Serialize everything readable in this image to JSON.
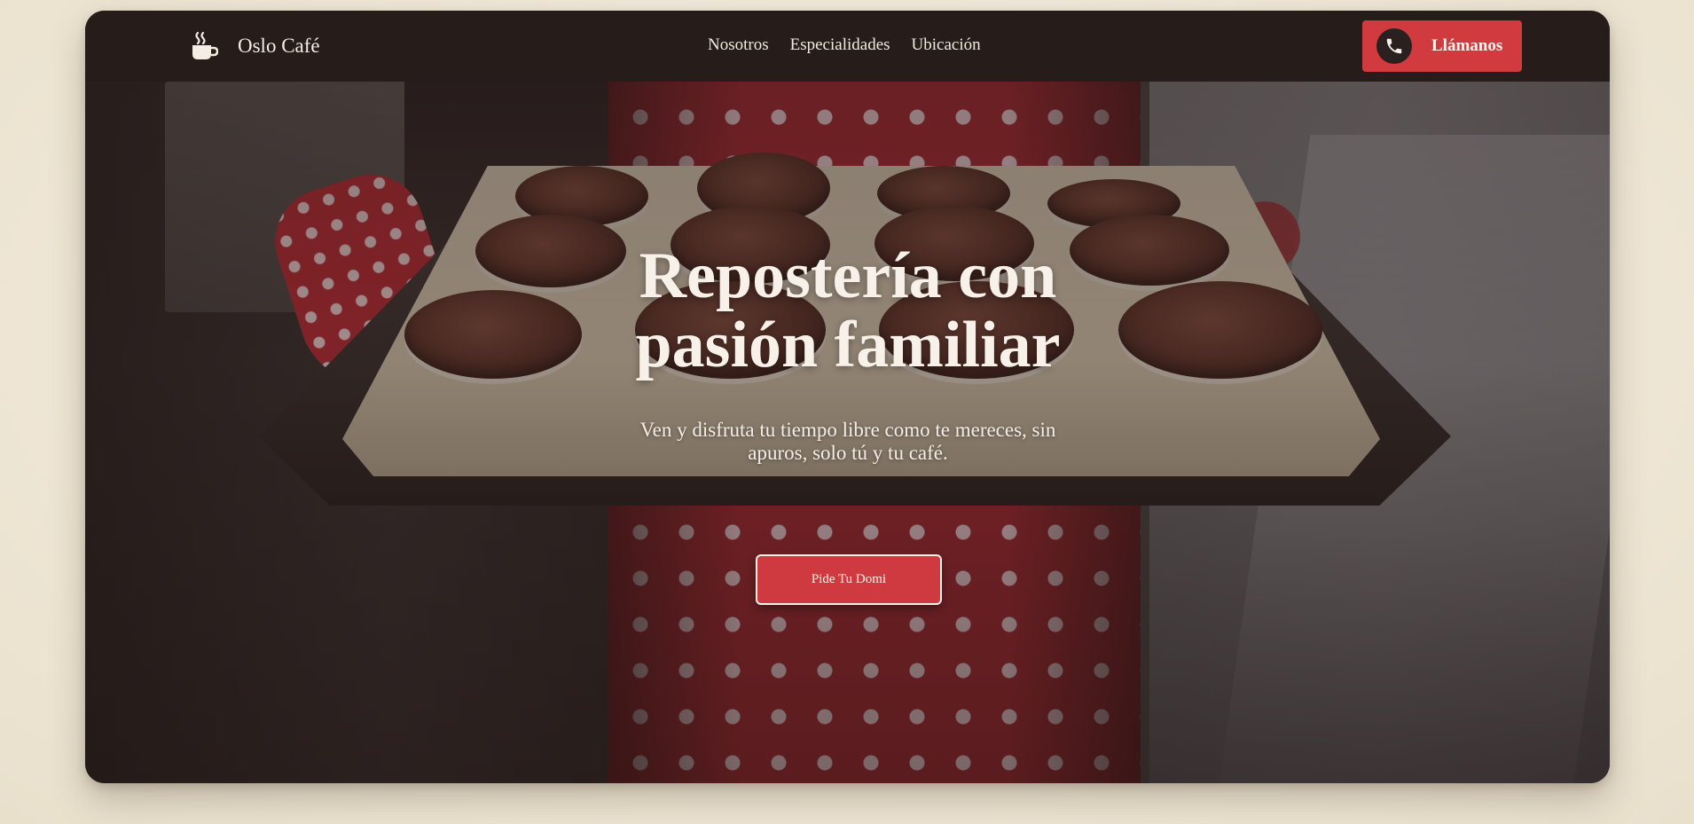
{
  "brand": {
    "name": "Oslo Café",
    "icon": "coffee-cup-icon"
  },
  "nav": {
    "links": [
      {
        "label": "Nosotros"
      },
      {
        "label": "Especialidades"
      },
      {
        "label": "Ubicación"
      }
    ],
    "call_button": {
      "label": "Llámanos",
      "icon": "phone-icon"
    }
  },
  "hero": {
    "headline_line1": "Repostería con",
    "headline_line2": "pasión familiar",
    "subtitle_line1": "Ven y disfruta tu tiempo libre como te mereces, sin",
    "subtitle_line2": "apuros, solo tú y tu café.",
    "cta_label": "Pide Tu Domi",
    "image": "muffin-tray-photo"
  },
  "colors": {
    "nav_bg": "#261c1a",
    "accent_red": "#d13b40",
    "page_bg": "#f1eadb",
    "text_light": "#f7f1ea"
  }
}
